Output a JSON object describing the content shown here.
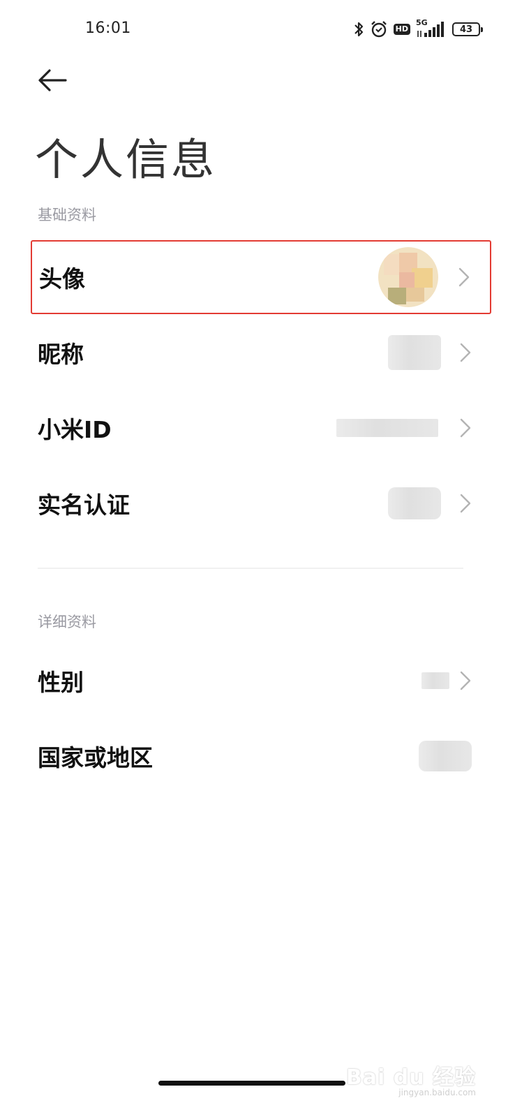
{
  "status_bar": {
    "time": "16:01",
    "network": "5G",
    "hd": "HD",
    "battery": "43",
    "icons": [
      "bluetooth-icon",
      "alarm-icon",
      "hd-icon",
      "signal-icon",
      "battery-icon"
    ]
  },
  "header": {
    "back_icon": "arrow-left-icon",
    "title": "个人信息"
  },
  "sections": [
    {
      "label": "基础资料",
      "items": [
        {
          "label": "头像",
          "value_type": "avatar-image",
          "highlighted": true
        },
        {
          "label": "昵称",
          "value_type": "blurred"
        },
        {
          "label": "小米ID",
          "value_type": "blurred"
        },
        {
          "label": "实名认证",
          "value_type": "blurred"
        }
      ]
    },
    {
      "label": "详细资料",
      "items": [
        {
          "label": "性别",
          "value_type": "blurred"
        },
        {
          "label": "国家或地区",
          "value_type": "blurred"
        }
      ]
    }
  ],
  "watermark": {
    "text": "Bai du 经验",
    "subtext": "jingyan.baidu.com"
  },
  "colors": {
    "highlight": "#e33b33",
    "section_label": "#9a9aa2",
    "chevron": "#b4b4b4"
  }
}
